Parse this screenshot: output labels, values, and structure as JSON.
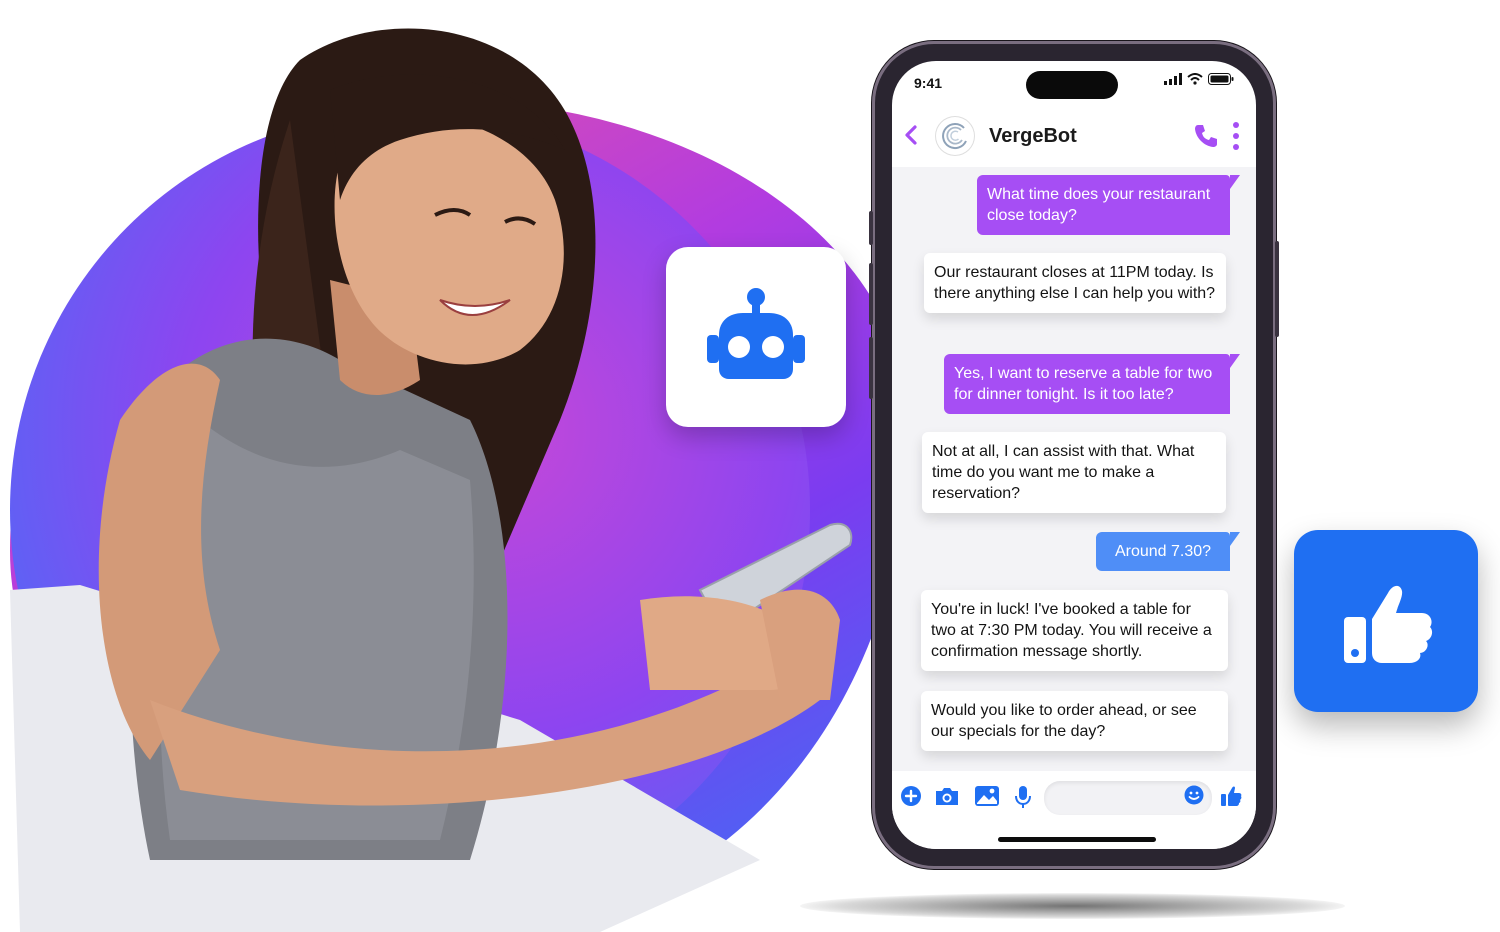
{
  "status": {
    "time": "9:41"
  },
  "header": {
    "bot_name": "VergeBot"
  },
  "messages": [
    {
      "side": "out",
      "text": "What time does your restaurant close today?"
    },
    {
      "side": "in",
      "text": "Our restaurant closes at 11PM today. Is there anything else I can help you with?"
    },
    {
      "side": "out",
      "text": "Yes, I want to reserve a table for two for dinner tonight. Is it too late?"
    },
    {
      "side": "in",
      "text": "Not at all, I can assist with that. What time do you want me to make a reservation?"
    },
    {
      "side": "out",
      "text": "Around 7.30?"
    },
    {
      "side": "in",
      "text": "You're in luck! I've booked a table for two at 7:30 PM today. You will receive a confirmation message shortly."
    },
    {
      "side": "in",
      "text": "Would you like to order ahead, or see our specials for the day?"
    }
  ],
  "composer": {
    "input_value": ""
  },
  "icons": {
    "robot": "robot-icon",
    "like": "thumbs-up-icon",
    "back": "chevron-left-icon",
    "call": "phone-icon",
    "more": "more-vertical-icon",
    "add": "plus-circle-icon",
    "camera": "camera-icon",
    "gallery": "image-icon",
    "mic": "microphone-icon",
    "emoji": "smiley-icon"
  },
  "colors": {
    "accent_purple": "#a64ef4",
    "accent_blue": "#1f6ff2",
    "bubble_blue": "#4f8ef7",
    "robot_blue": "#1f6ff2"
  }
}
